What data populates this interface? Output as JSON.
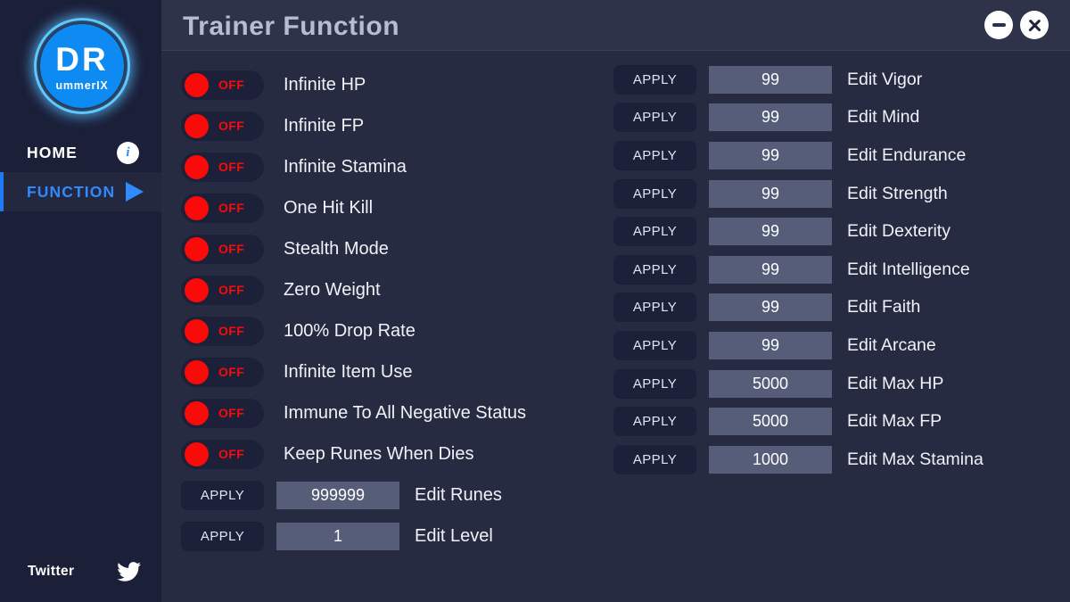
{
  "app": {
    "window_title": "Trainer Function",
    "accent_blue": "#2f8bff",
    "toggle_red": "#fb0a0a",
    "sidebar_bg": "#1b1f38",
    "main_bg": "#262b42",
    "header_bg": "#2e3349",
    "field_bg": "#555d78"
  },
  "sidebar": {
    "logo": {
      "primary": "DR",
      "secondary": "ummerIX"
    },
    "items": [
      {
        "label": "HOME",
        "icon": "info-icon",
        "active": false
      },
      {
        "label": "FUNCTION",
        "icon": "play-icon",
        "active": true
      }
    ],
    "footer": {
      "label": "Twitter",
      "icon": "twitter-bird-icon"
    }
  },
  "header": {
    "title": "Trainer Function",
    "minimize_icon": "minimize-icon",
    "close_icon": "close-icon"
  },
  "toggles": [
    {
      "label": "Infinite HP",
      "state": "OFF"
    },
    {
      "label": "Infinite FP",
      "state": "OFF"
    },
    {
      "label": "Infinite Stamina",
      "state": "OFF"
    },
    {
      "label": "One Hit Kill",
      "state": "OFF"
    },
    {
      "label": "Stealth Mode",
      "state": "OFF"
    },
    {
      "label": "Zero Weight",
      "state": "OFF"
    },
    {
      "label": "100% Drop Rate",
      "state": "OFF"
    },
    {
      "label": "Infinite Item Use",
      "state": "OFF"
    },
    {
      "label": "Immune To All Negative Status",
      "state": "OFF"
    },
    {
      "label": "Keep Runes When Dies",
      "state": "OFF"
    }
  ],
  "left_fields": [
    {
      "button": "APPLY",
      "value": "999999",
      "label": "Edit Runes"
    },
    {
      "button": "APPLY",
      "value": "1",
      "label": "Edit Level"
    }
  ],
  "right_fields": [
    {
      "button": "APPLY",
      "value": "99",
      "label": "Edit Vigor"
    },
    {
      "button": "APPLY",
      "value": "99",
      "label": "Edit Mind"
    },
    {
      "button": "APPLY",
      "value": "99",
      "label": "Edit Endurance"
    },
    {
      "button": "APPLY",
      "value": "99",
      "label": "Edit Strength"
    },
    {
      "button": "APPLY",
      "value": "99",
      "label": "Edit Dexterity"
    },
    {
      "button": "APPLY",
      "value": "99",
      "label": "Edit Intelligence"
    },
    {
      "button": "APPLY",
      "value": "99",
      "label": "Edit Faith"
    },
    {
      "button": "APPLY",
      "value": "99",
      "label": "Edit Arcane"
    },
    {
      "button": "APPLY",
      "value": "5000",
      "label": "Edit Max HP"
    },
    {
      "button": "APPLY",
      "value": "5000",
      "label": "Edit Max FP"
    },
    {
      "button": "APPLY",
      "value": "1000",
      "label": "Edit Max Stamina"
    }
  ]
}
